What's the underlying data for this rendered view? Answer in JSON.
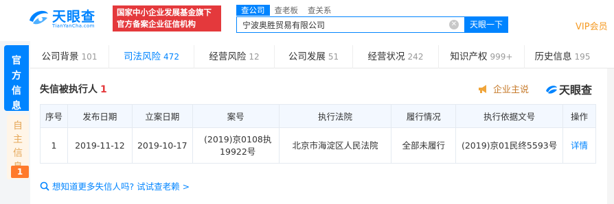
{
  "brand": {
    "name": "天眼查",
    "url": "TianYanCha.com",
    "banner_line1": "国家中小企业发展基金旗下",
    "banner_line2": "官方备案企业征信机构",
    "colors": {
      "primary": "#0084ff",
      "accent_red": "#e4393c",
      "vip_orange": "#f59a23"
    }
  },
  "search": {
    "tabs": [
      "查公司",
      "查老板",
      "查关系"
    ],
    "value": "宁波奥胜贸易有限公司",
    "button_label": "天眼一下",
    "vip_label": "VIP会员"
  },
  "rail": {
    "official_label": [
      "官",
      "方",
      "信",
      "息"
    ],
    "self_label": [
      "自",
      "主",
      "信",
      "息"
    ],
    "self_badge": "1"
  },
  "nav": {
    "tabs": [
      {
        "label": "公司背景",
        "count": "101"
      },
      {
        "label": "司法风险",
        "count": "472"
      },
      {
        "label": "经营风险",
        "count": "12"
      },
      {
        "label": "公司发展",
        "count": "51"
      },
      {
        "label": "经营状况",
        "count": "242"
      },
      {
        "label": "知识产权",
        "count": "999+"
      },
      {
        "label": "历史信息",
        "count": "195"
      }
    ],
    "active_index": 1
  },
  "section": {
    "title": "失信被执行人",
    "count": "1",
    "claim_label": "企业主说",
    "brand_label": "天眼查"
  },
  "table": {
    "headers": [
      "序号",
      "发布日期",
      "立案日期",
      "案号",
      "执行法院",
      "履行情况",
      "执行依据文号",
      "操作"
    ],
    "rows": [
      {
        "index": "1",
        "publish_date": "2019-11-12",
        "filing_date": "2019-10-17",
        "case_no": "(2019)京0108执19922号",
        "court": "北京市海淀区人民法院",
        "status": "全部未履行",
        "basis_no": "(2019)京01民终5593号",
        "action": "详情"
      }
    ]
  },
  "more_link": "想知道更多失信人吗? 试试查老赖 >"
}
